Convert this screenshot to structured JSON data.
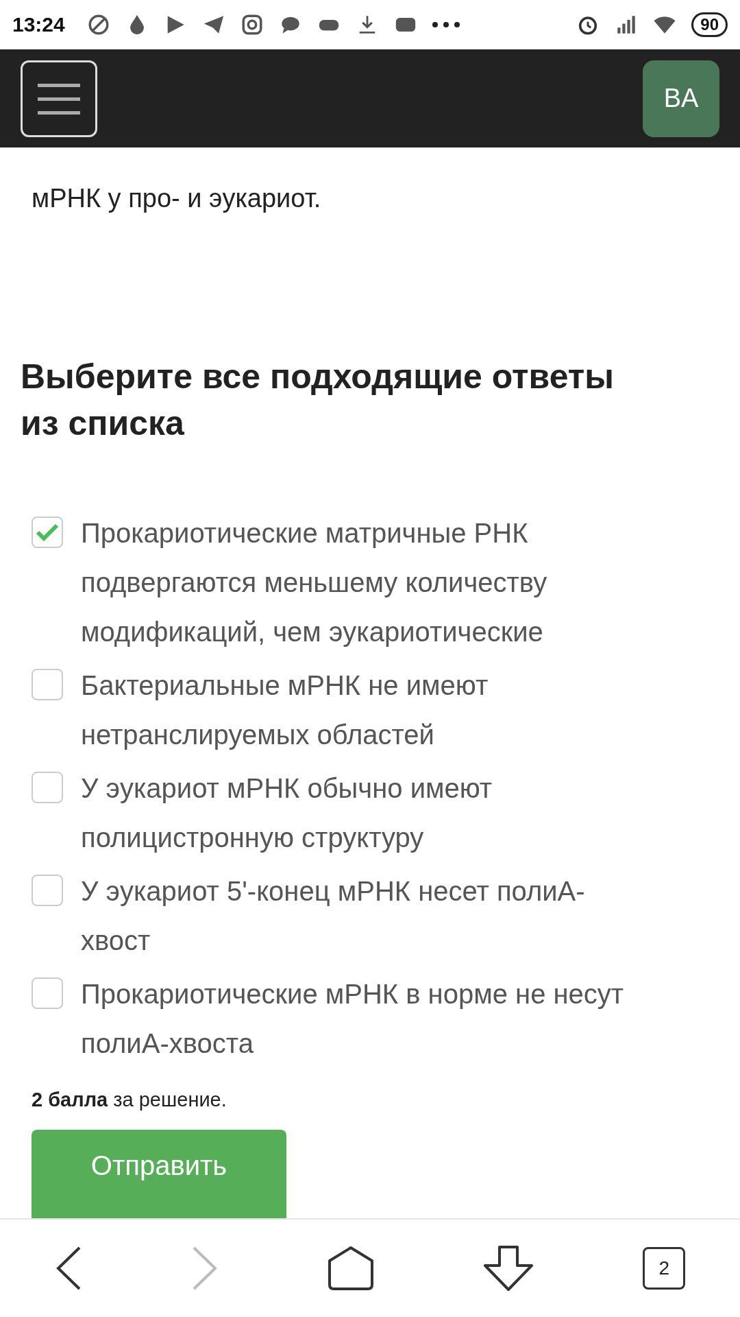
{
  "status_bar": {
    "time": "13:24",
    "battery": "90"
  },
  "header": {
    "avatar": "BA"
  },
  "question": "мРНК у про- и эукариот.",
  "heading": "Выберите все подходящие ответы из списка",
  "options": [
    {
      "label": "Прокариотические матричные РНК подвергаются меньшему количеству модификаций, чем эукариотические",
      "checked": true
    },
    {
      "label": "Бактериальные мРНК не имеют нетранслируемых областей",
      "checked": false
    },
    {
      "label": "У эукариот мРНК обычно имеют полицистронную структуру",
      "checked": false
    },
    {
      "label": "У эукариот 5'-конец мРНК несет полиА-хвост",
      "checked": false
    },
    {
      "label": "Прокариотические мРНК в норме не несут полиА-хвоста",
      "checked": false
    }
  ],
  "points": "**2 балла** за решение.",
  "submit": "Отправить",
  "nav": {
    "tabs": "2"
  }
}
